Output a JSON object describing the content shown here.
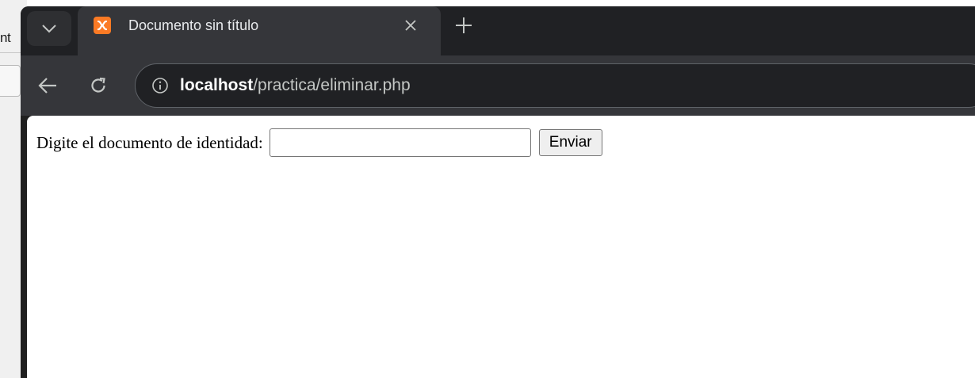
{
  "background_window": {
    "fragment_text": "nt"
  },
  "browser": {
    "tab": {
      "title": "Documento sin título",
      "favicon": "xampp-icon"
    },
    "address_bar": {
      "host": "localhost",
      "path": "/practica/eliminar.php"
    },
    "colors": {
      "tabstrip": "#202124",
      "toolbar": "#35363a",
      "favicon": "#fb7a24"
    }
  },
  "page": {
    "form": {
      "label": "Digite el documento de identidad:",
      "input_value": "",
      "submit_label": "Enviar"
    }
  }
}
